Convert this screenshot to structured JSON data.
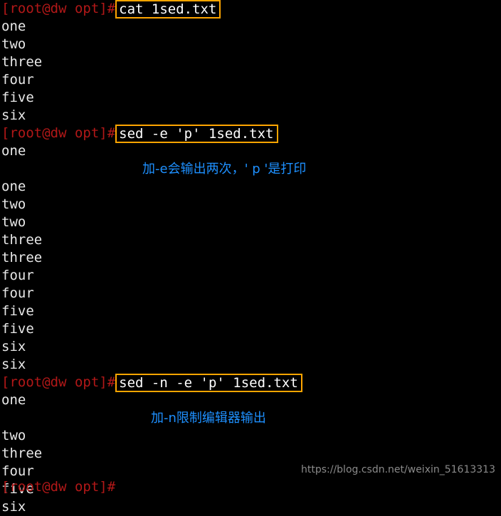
{
  "terminal": {
    "prompt": "[root@dw opt]#",
    "prompt_color": "#b21818",
    "output_color": "#e8e8e8",
    "annotation_color": "#1e90ff",
    "command_box_border_color": "#ffa500",
    "background_color": "#000000",
    "blocks": [
      {
        "command": "cat 1sed.txt",
        "output": [
          "one",
          "two",
          "three",
          "four",
          "five",
          "six"
        ],
        "annotation": ""
      },
      {
        "command": "sed -e 'p' 1sed.txt",
        "annotation": "加-e会输出两次，' p '是打印",
        "output": [
          "one",
          "one",
          "two",
          "two",
          "three",
          "three",
          "four",
          "four",
          "five",
          "five",
          "six",
          "six"
        ]
      },
      {
        "command": "sed -n -e 'p' 1sed.txt",
        "annotation": "加-n限制编辑器输出",
        "output": [
          "one",
          "two",
          "three",
          "four",
          "five",
          "six"
        ]
      }
    ],
    "trailing_prompt": "[root@dw opt]#"
  },
  "watermark": {
    "text": "https://blog.csdn.net/weixin_51613313"
  }
}
